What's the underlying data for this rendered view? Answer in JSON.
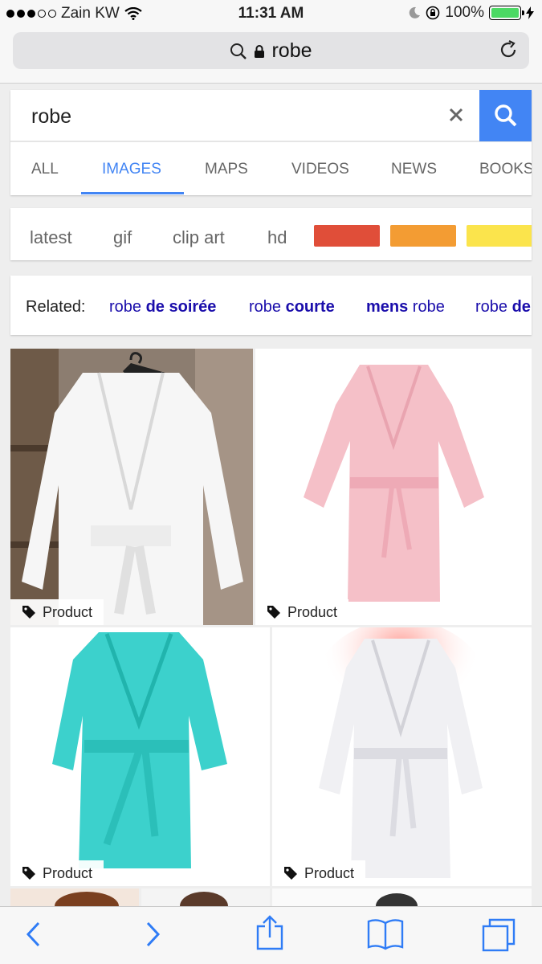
{
  "status_bar": {
    "carrier": "Zain KW",
    "time": "11:31 AM",
    "battery": "100%"
  },
  "address_bar": {
    "url_text": "robe"
  },
  "search": {
    "query": "robe"
  },
  "tabs": [
    {
      "label": "ALL"
    },
    {
      "label": "IMAGES",
      "active": true
    },
    {
      "label": "MAPS"
    },
    {
      "label": "VIDEOS"
    },
    {
      "label": "NEWS"
    },
    {
      "label": "BOOKS"
    }
  ],
  "filters": {
    "chips": [
      "latest",
      "gif",
      "clip art",
      "hd"
    ],
    "color_swatches": [
      "#e04e39",
      "#f39c33",
      "#fbe44c"
    ]
  },
  "related": {
    "label": "Related:",
    "items": [
      {
        "plain": "robe ",
        "bold": "de soirée"
      },
      {
        "plain": "robe ",
        "bold": "courte"
      },
      {
        "bold": "mens",
        "plain": " robe"
      },
      {
        "plain": "robe ",
        "bold": "de"
      }
    ]
  },
  "results": [
    {
      "badge": "Product",
      "desc": "white-robe-on-hanger"
    },
    {
      "badge": "Product",
      "desc": "pink-robe"
    },
    {
      "badge": "Product",
      "desc": "turquoise-robe"
    },
    {
      "badge": "Product",
      "desc": "white-robe-glow"
    }
  ],
  "toolbar": {
    "icons": [
      "back-icon",
      "forward-icon",
      "share-icon",
      "bookmarks-icon",
      "tabs-icon"
    ]
  }
}
